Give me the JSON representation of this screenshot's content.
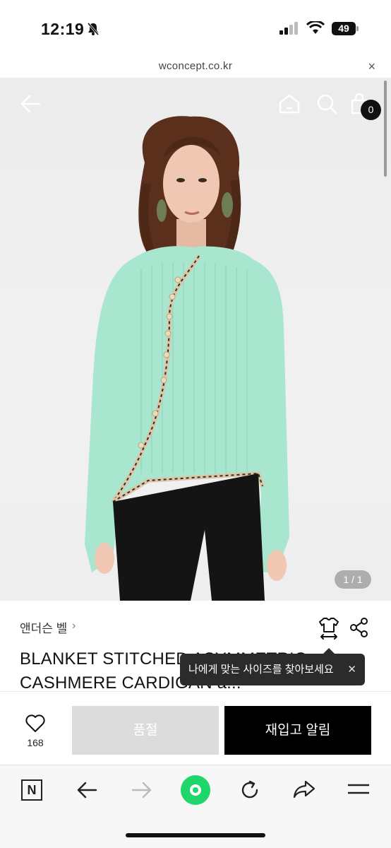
{
  "status_bar": {
    "time": "12:19",
    "battery": "49"
  },
  "url_bar": {
    "url": "wconcept.co.kr",
    "close": "×"
  },
  "hero": {
    "cart_count": "0",
    "image_counter": "1 / 1"
  },
  "product": {
    "brand": "앤더슨 벨",
    "title_line1": "BLANKET STITCHED ASYMMETRIC",
    "title_line2": "CASHMERE CARDIGAN a...",
    "size_tooltip": "나에게 맞는 사이즈를 찾아보세요"
  },
  "actions": {
    "likes": "168",
    "soldout_label": "품절",
    "restock_label": "재입고 알림"
  },
  "icons": [
    "bell-mute-icon",
    "signal-icon",
    "wifi-icon",
    "battery-icon",
    "back-arrow-icon",
    "home-icon",
    "search-icon",
    "shopping-bag-icon",
    "size-guide-icon",
    "share-icon",
    "heart-icon",
    "naver-icon",
    "browser-back-icon",
    "browser-forward-icon",
    "green-dot-icon",
    "refresh-icon",
    "share-arrow-icon",
    "menu-icon"
  ],
  "colors": {
    "knit": "#a9e6cf",
    "soldout_bg": "#dcdcdc",
    "restock_bg": "#000000",
    "naver_green": "#1fd66b"
  }
}
